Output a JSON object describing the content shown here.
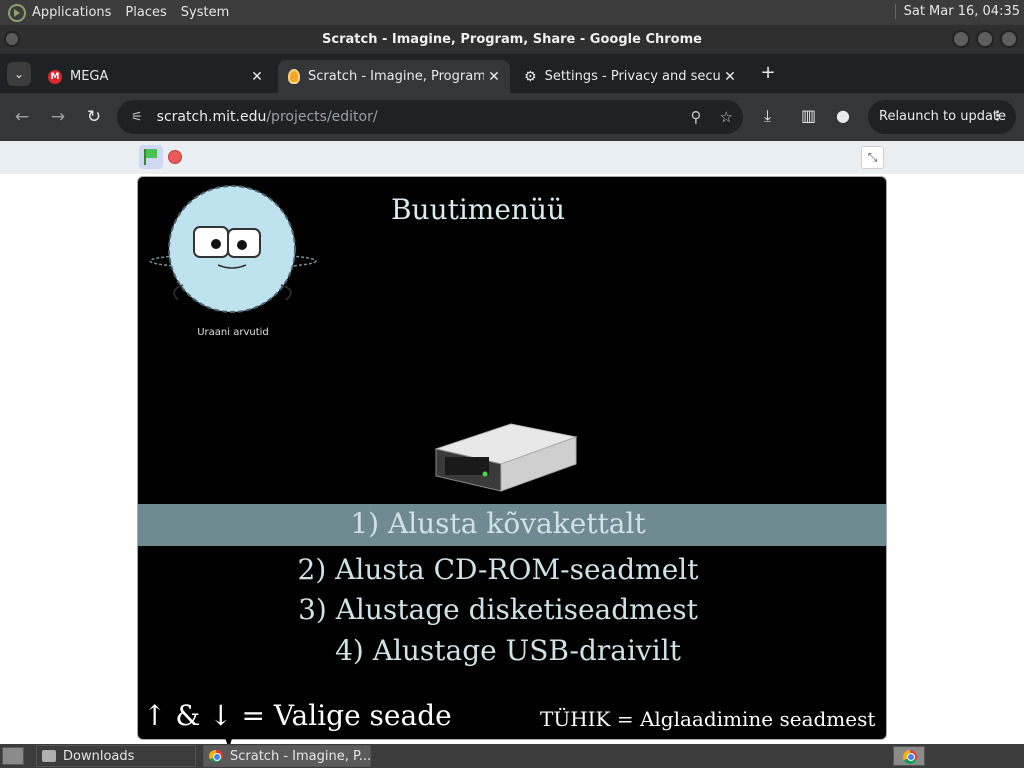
{
  "top_panel": {
    "menus": [
      "Applications",
      "Places",
      "System"
    ],
    "clock": "Sat Mar 16, 04:35"
  },
  "window": {
    "title": "Scratch - Imagine, Program, Share - Google Chrome"
  },
  "tabs": [
    {
      "title": "MEGA",
      "icon": "mega-icon"
    },
    {
      "title": "Scratch - Imagine, Program, Share",
      "icon": "scratch-icon",
      "active": true
    },
    {
      "title": "Settings - Privacy and security",
      "icon": "gear-icon"
    }
  ],
  "toolbar": {
    "url_host": "scratch.mit.edu",
    "url_path": "/projects/editor/",
    "relaunch_label": "Relaunch to update"
  },
  "stage": {
    "title": "Buutimenüü",
    "mascot_caption": "Uraani arvutid",
    "options": [
      "1) Alusta kõvakettalt",
      "2) Alusta CD-ROM-seadmelt",
      "3) Alustage disketiseadmest",
      "4) Alustage USB-draivilt"
    ],
    "selected_option": 0,
    "hint_left": "↑ & ↓ = Valige seade",
    "hint_right": "TÜHIK = Alglaadimine seadmest"
  },
  "taskbar": {
    "tasks": [
      {
        "label": "Downloads",
        "icon": "folder-icon"
      },
      {
        "label": "Scratch - Imagine, P...",
        "icon": "chrome-icon",
        "active": true
      }
    ]
  },
  "colors": {
    "stage_bg": "#000000",
    "highlight": "#6f8a90",
    "stage_text": "#cfe2e8"
  }
}
